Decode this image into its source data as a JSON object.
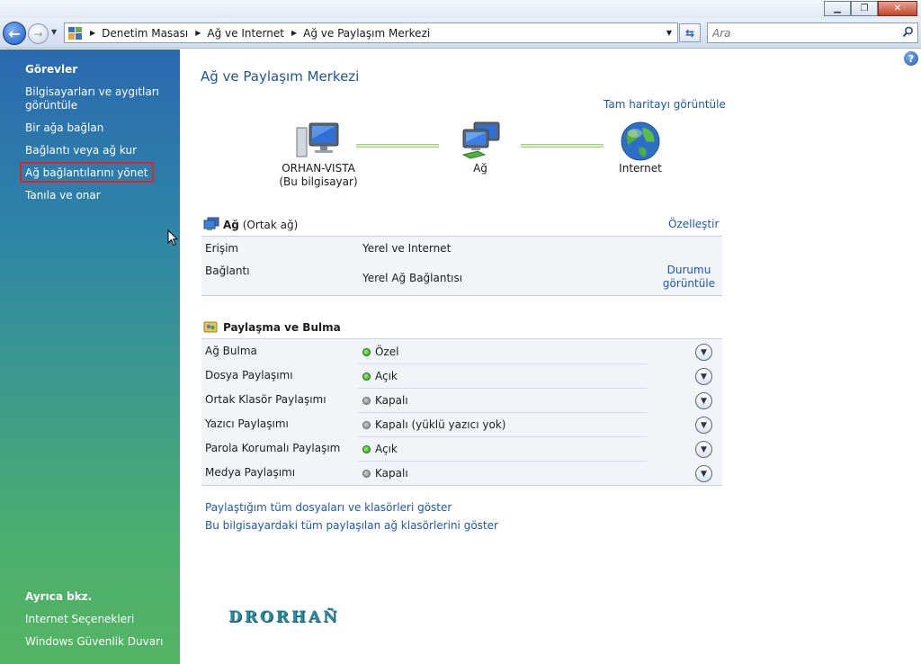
{
  "window": {
    "minimize_label": "▁",
    "maximize_label": "❐",
    "close_label": "✕"
  },
  "address": {
    "breadcrumb": [
      "Denetim Masası",
      "Ağ ve Internet",
      "Ağ ve Paylaşım Merkezi"
    ],
    "search_placeholder": "Ara"
  },
  "sidebar": {
    "tasks_title": "Görevler",
    "tasks": [
      "Bilgisayarları ve aygıtları görüntüle",
      "Bir ağa bağlan",
      "Bağlantı veya ağ kur",
      "Ağ bağlantılarını yönet",
      "Tanıla ve onar"
    ],
    "highlighted_task": 3,
    "see_also_title": "Ayrıca bkz.",
    "see_also": [
      "Internet Seçenekleri",
      "Windows Güvenlik Duvarı"
    ]
  },
  "main": {
    "title": "Ağ ve Paylaşım Merkezi",
    "full_map_link": "Tam haritayı görüntüle",
    "map": {
      "computer_name": "ORHAN-VISTA",
      "computer_sub": "(Bu bilgisayar)",
      "network": "Ağ",
      "internet": "Internet"
    },
    "network_section": {
      "name": "Ağ",
      "type": "(Ortak ağ)",
      "customize": "Özelleştir",
      "access_label": "Erişim",
      "access_value": "Yerel ve Internet",
      "connection_label": "Bağlantı",
      "connection_value": "Yerel Ağ Bağlantısı",
      "view_status": "Durumu görüntüle"
    },
    "sharing_section": {
      "title": "Paylaşma ve Bulma",
      "rows": [
        {
          "label": "Ağ Bulma",
          "value": "Özel",
          "on": true
        },
        {
          "label": "Dosya Paylaşımı",
          "value": "Açık",
          "on": true
        },
        {
          "label": "Ortak Klasör Paylaşımı",
          "value": "Kapalı",
          "on": false
        },
        {
          "label": "Yazıcı Paylaşımı",
          "value": "Kapalı (yüklü yazıcı yok)",
          "on": false
        },
        {
          "label": "Parola Korumalı Paylaşım",
          "value": "Açık",
          "on": true
        },
        {
          "label": "Medya Paylaşımı",
          "value": "Kapalı",
          "on": false
        }
      ]
    },
    "bottom_links": [
      "Paylaştığım tüm dosyaları ve klasörleri göster",
      "Bu bilgisayardaki tüm paylaşılan ağ klasörlerini göster"
    ],
    "watermark": "DRORHAÑ"
  },
  "colors": {
    "link": "#1f57b3",
    "title": "#1e5499",
    "status_on": "#1f9a16",
    "status_off": "#7a7a7a",
    "highlight_box": "#e02424"
  }
}
